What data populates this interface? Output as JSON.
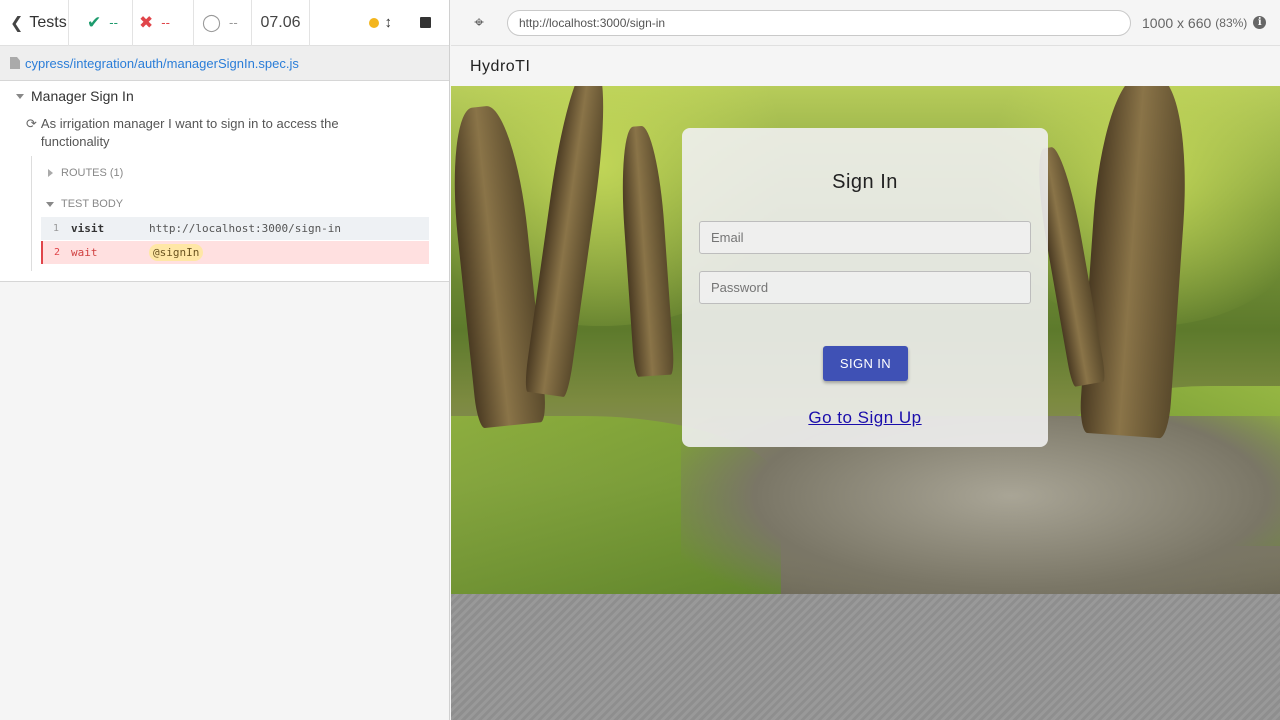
{
  "reporter": {
    "tests_label": "Tests",
    "passed_count": "--",
    "failed_count": "--",
    "pending_count": "--",
    "duration": "07.06",
    "spec_path": "cypress/integration/auth/managerSignIn.spec.js",
    "suite_title": "Manager Sign In",
    "test_title": "As irrigation manager I want to sign in to access the functionality",
    "routes_label": "ROUTES (1)",
    "test_body_label": "TEST BODY",
    "commands": [
      {
        "num": "1",
        "name": "visit",
        "message": "http://localhost:3000/sign-in",
        "state": "passed"
      },
      {
        "num": "2",
        "name": "wait",
        "message": "@signIn",
        "state": "failed"
      }
    ],
    "colors": {
      "passed": "#1d9b6d",
      "failed": "#e0454a",
      "running_dot": "#f3b51d"
    }
  },
  "aut_header": {
    "url": "http://localhost:3000/sign-in",
    "viewport": "1000 x 660",
    "scale": "(83%)"
  },
  "app": {
    "brand": "HydroTI",
    "card_title": "Sign In",
    "email_placeholder": "Email",
    "password_placeholder": "Password",
    "sign_in_button": "SIGN IN",
    "signup_link": "Go to Sign Up",
    "accent_color": "#3f51b5"
  },
  "icons": {
    "back": "chevron-left-icon",
    "passed": "check-icon",
    "failed": "x-icon",
    "pending": "circle-notch-icon",
    "stop": "stop-icon",
    "selector": "crosshair-icon",
    "info": "info-icon",
    "refresh": "refresh-icon",
    "file": "file-icon"
  }
}
